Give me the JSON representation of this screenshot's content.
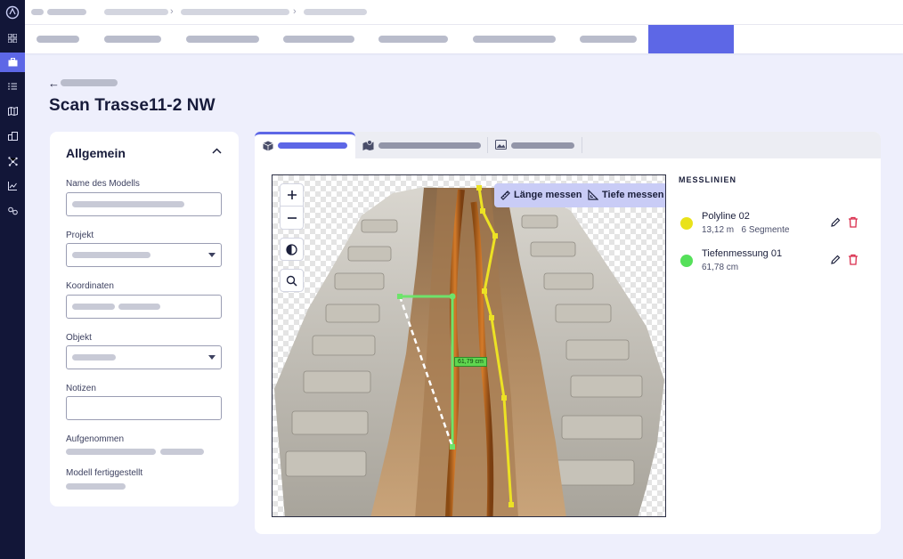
{
  "page": {
    "title": "Scan Trasse11-2 NW",
    "back_arrow": "←"
  },
  "general": {
    "heading": "Allgemein",
    "fields": [
      {
        "label": "Name des Modells"
      },
      {
        "label": "Projekt"
      },
      {
        "label": "Koordinaten"
      },
      {
        "label": "Objekt"
      },
      {
        "label": "Notizen"
      },
      {
        "label": "Aufgenommen"
      },
      {
        "label": "Modell fertiggestellt"
      }
    ]
  },
  "viewer": {
    "buttons": {
      "length": "Länge messen",
      "depth": "Tiefe messen"
    },
    "measurement_label": "61,79 cm",
    "tools": [
      "zoom-in-icon",
      "zoom-out-icon",
      "contrast-icon",
      "search-icon"
    ]
  },
  "measurements": {
    "heading": "MESSLINIEN",
    "items": [
      {
        "name": "Polyline 02",
        "value": "13,12 m",
        "segments": "6 Segmente",
        "color": "#e9e21a"
      },
      {
        "name": "Tiefenmessung 01",
        "value": "61,78 cm",
        "segments": "",
        "color": "#55e05a"
      }
    ]
  },
  "colors": {
    "accent": "#5d67e6",
    "rail": "#121638",
    "delete": "#d92b4b",
    "measure_green": "#6ee36b",
    "polyline_yellow": "#ece224"
  }
}
